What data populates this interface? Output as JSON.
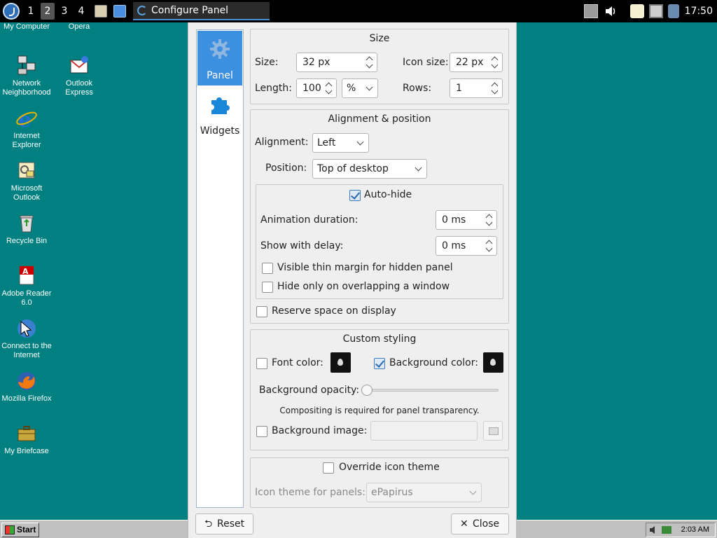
{
  "top_panel": {
    "workspaces": [
      "1",
      "2",
      "3",
      "4"
    ],
    "active_workspace": "2",
    "task_title": "Configure Panel",
    "clock": "17:50"
  },
  "desktop_icons": [
    {
      "label": "My Computer",
      "icon": "my-computer-icon"
    },
    {
      "label": "Opera",
      "icon": "opera-icon"
    },
    {
      "label": "Network Neighborhood",
      "icon": "network-neighborhood-icon"
    },
    {
      "label": "Outlook Express",
      "icon": "outlook-express-icon"
    },
    {
      "label": "Internet Explorer",
      "icon": "internet-explorer-icon"
    },
    {
      "label": "Microsoft Outlook",
      "icon": "microsoft-outlook-icon"
    },
    {
      "label": "Recycle Bin",
      "icon": "recycle-bin-icon"
    },
    {
      "label": "Adobe Reader 6.0",
      "icon": "adobe-reader-icon"
    },
    {
      "label": "Connect to the Internet",
      "icon": "connect-internet-icon"
    },
    {
      "label": "Mozilla Firefox",
      "icon": "firefox-icon"
    },
    {
      "label": "My Briefcase",
      "icon": "briefcase-icon"
    }
  ],
  "taskbar": {
    "start_label": "Start",
    "tray_time": "2:03 AM"
  },
  "dialog": {
    "sidebar": [
      {
        "label": "Panel",
        "icon": "gear-icon",
        "active": true
      },
      {
        "label": "Widgets",
        "icon": "puzzle-icon",
        "active": false
      }
    ],
    "size_group": {
      "title": "Size",
      "size_label": "Size:",
      "size_value": "32 px",
      "icon_size_label": "Icon size:",
      "icon_size_value": "22 px",
      "length_label": "Length:",
      "length_value": "100",
      "length_unit": "%",
      "rows_label": "Rows:",
      "rows_value": "1"
    },
    "alignment_group": {
      "title": "Alignment & position",
      "alignment_label": "Alignment:",
      "alignment_value": "Left",
      "position_label": "Position:",
      "position_value": "Top of desktop",
      "autohide_label": "Auto-hide",
      "autohide_checked": true,
      "animation_label": "Animation duration:",
      "animation_value": "0 ms",
      "delay_label": "Show with delay:",
      "delay_value": "0 ms",
      "thin_margin_label": "Visible thin margin for hidden panel",
      "overlap_label": "Hide only on overlapping a window",
      "reserve_label": "Reserve space on display"
    },
    "styling_group": {
      "title": "Custom styling",
      "font_color_label": "Font color:",
      "bg_color_label": "Background color:",
      "bg_color_checked": true,
      "opacity_label": "Background opacity:",
      "opacity_value": 0,
      "compositing_note": "Compositing is required for panel transparency.",
      "bg_image_label": "Background image:"
    },
    "icon_theme_group": {
      "override_label": "Override icon theme",
      "theme_label": "Icon theme for panels:",
      "theme_value": "ePapirus"
    },
    "buttons": {
      "reset_label": "Reset",
      "close_label": "Close"
    }
  }
}
